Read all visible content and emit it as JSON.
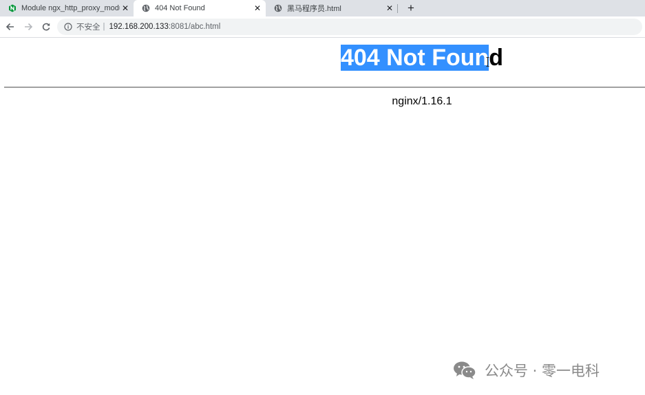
{
  "tabs": [
    {
      "title": "Module ngx_http_proxy_modu",
      "close": "✕",
      "icon": "nginx-icon",
      "active": false
    },
    {
      "title": "404 Not Found",
      "close": "✕",
      "icon": "globe-icon",
      "active": true
    },
    {
      "title": "黑马程序员.html",
      "close": "✕",
      "icon": "globe-icon",
      "active": false
    }
  ],
  "new_tab": "+",
  "address_bar": {
    "security_label": "不安全",
    "separator": "|",
    "host": "192.168.200.133",
    "path": ":8081/abc.html"
  },
  "page": {
    "heading_selected": "404 Not Foun",
    "heading_rest": "d",
    "server_signature": "nginx/1.16.1"
  },
  "watermark": {
    "text": "公众号 · 零一电科",
    "icon": "wechat-icon"
  },
  "colors": {
    "tabstrip_bg": "#dee1e6",
    "selection": "#3390ff",
    "omnibox_bg": "#f1f3f4",
    "nginx_green": "#009639"
  }
}
